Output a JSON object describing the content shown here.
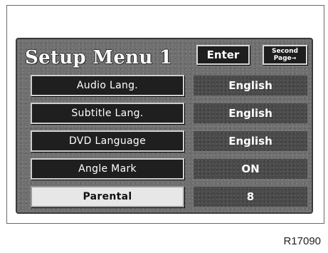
{
  "title": "Setup Menu 1",
  "header": {
    "enter_label": "Enter",
    "second_page_line1": "Second",
    "second_page_line2": "Page",
    "second_page_arrow": "→"
  },
  "menu": {
    "rows": [
      {
        "label": "Audio Lang.",
        "value": "English",
        "selected": false
      },
      {
        "label": "Subtitle Lang.",
        "value": "English",
        "selected": false
      },
      {
        "label": "DVD Language",
        "value": "English",
        "selected": false
      },
      {
        "label": "Angle Mark",
        "value": "ON",
        "selected": false
      },
      {
        "label": "Parental",
        "value": "8",
        "selected": true
      }
    ]
  },
  "figure_code": "R17090",
  "colors": {
    "screen_bg": "#6f6f6f",
    "button_bg": "#1f1f1f",
    "selected_button_bg": "#e7e7e7",
    "value_bg": "#4a4a4a"
  }
}
